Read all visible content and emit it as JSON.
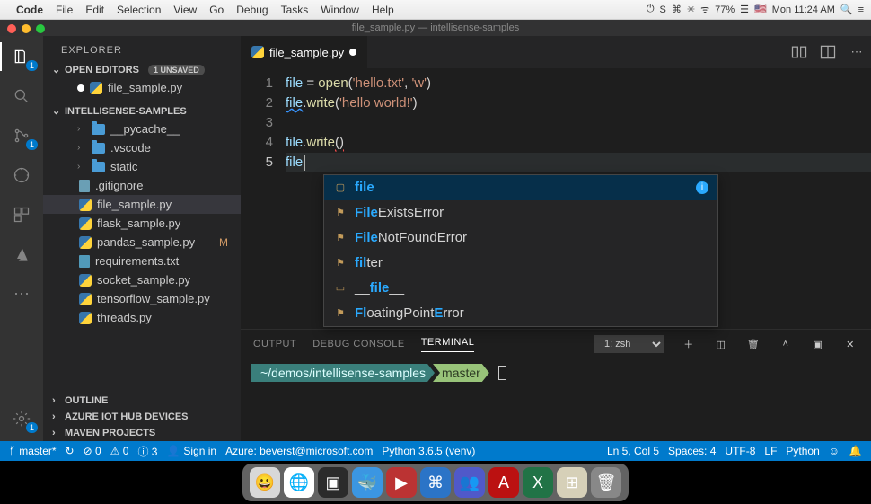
{
  "mac_menu": {
    "apple": "",
    "app": "Code",
    "items": [
      "File",
      "Edit",
      "Selection",
      "View",
      "Go",
      "Debug",
      "Tasks",
      "Window",
      "Help"
    ],
    "status_right": [
      "⏻",
      "S",
      "⌘",
      "✳",
      "ᯤ",
      "77%",
      "☰",
      "🇺🇸",
      "Mon 11:24 AM",
      "🔍",
      "≡"
    ]
  },
  "titlebar": "file_sample.py — intellisense-samples",
  "sidebar": {
    "title": "EXPLORER",
    "open_editors": {
      "label": "OPEN EDITORS",
      "badge": "1 UNSAVED"
    },
    "open_editor_item": "file_sample.py",
    "project": "INTELLISENSE-SAMPLES",
    "folders": [
      "__pycache__",
      ".vscode",
      "static"
    ],
    "files": [
      {
        "name": ".gitignore",
        "icon": "file"
      },
      {
        "name": "file_sample.py",
        "icon": "py",
        "selected": true
      },
      {
        "name": "flask_sample.py",
        "icon": "py"
      },
      {
        "name": "pandas_sample.py",
        "icon": "py",
        "modified": true
      },
      {
        "name": "requirements.txt",
        "icon": "txt"
      },
      {
        "name": "socket_sample.py",
        "icon": "py"
      },
      {
        "name": "tensorflow_sample.py",
        "icon": "py"
      },
      {
        "name": "threads.py",
        "icon": "py"
      }
    ],
    "sections_collapsed": [
      "OUTLINE",
      "AZURE IOT HUB DEVICES",
      "MAVEN PROJECTS"
    ]
  },
  "activity_badges": {
    "explorer": "1",
    "scm": "1",
    "settings": "1"
  },
  "tab": {
    "name": "file_sample.py"
  },
  "code": {
    "lines": [
      {
        "n": 1,
        "segs": [
          [
            "var",
            "file"
          ],
          [
            "op",
            " = "
          ],
          [
            "fn",
            "open"
          ],
          [
            "op",
            "("
          ],
          [
            "str",
            "'hello.txt'"
          ],
          [
            "op",
            ", "
          ],
          [
            "str",
            "'w'"
          ],
          [
            "op",
            ")"
          ]
        ]
      },
      {
        "n": 2,
        "segs": [
          [
            "var hint",
            "file"
          ],
          [
            "op",
            "."
          ],
          [
            "fn",
            "write"
          ],
          [
            "op",
            "("
          ],
          [
            "str",
            "'hello world!'"
          ],
          [
            "op",
            ")"
          ]
        ]
      },
      {
        "n": 3,
        "segs": []
      },
      {
        "n": 4,
        "segs": [
          [
            "var",
            "file"
          ],
          [
            "op",
            "."
          ],
          [
            "fn",
            "write"
          ],
          [
            "op err",
            "()"
          ]
        ]
      },
      {
        "n": 5,
        "active": true,
        "segs": [
          [
            "var",
            "file"
          ]
        ]
      }
    ]
  },
  "suggest": [
    {
      "icon": "▢",
      "pre": "",
      "hl": "file",
      "post": "",
      "selected": true,
      "info": true
    },
    {
      "icon": "⚑",
      "pre": "",
      "hl": "File",
      "post": "ExistsError"
    },
    {
      "icon": "⚑",
      "pre": "",
      "hl": "File",
      "post": "NotFoundError"
    },
    {
      "icon": "⚑",
      "pre": "",
      "hl": "fil",
      "post": "ter"
    },
    {
      "icon": "▭",
      "pre": "__",
      "hl": "file",
      "post": "__"
    },
    {
      "icon": "⚑",
      "pre": "",
      "hl": "Fl",
      "post": "oatingPoint",
      "hl2": "E",
      "post2": "rror"
    }
  ],
  "panel": {
    "tabs": [
      "OUTPUT",
      "DEBUG CONSOLE",
      "TERMINAL"
    ],
    "active_tab": "TERMINAL",
    "select": "1: zsh",
    "prompt_path": "~/demos/intellisense-samples",
    "prompt_branch": " master"
  },
  "status": {
    "branch": "master*",
    "sync": "↻",
    "errors": "⊘ 0",
    "warnings": "⚠ 0",
    "info": "ⓘ 3",
    "signin": "Sign in",
    "azure": "Azure: beverst@microsoft.com",
    "python": "Python 3.6.5 (venv)",
    "ln": "Ln 5, Col 5",
    "spaces": "Spaces: 4",
    "enc": "UTF-8",
    "eol": "LF",
    "lang": "Python",
    "smile": "☺",
    "bell": "🔔"
  },
  "dock_icons": [
    {
      "bg": "#d8d8d8",
      "g": "😀"
    },
    {
      "bg": "#fff",
      "g": "🌐"
    },
    {
      "bg": "#2b2b2b",
      "g": "▣"
    },
    {
      "bg": "#3b96e2",
      "g": "🐳"
    },
    {
      "bg": "#b33",
      "g": "▶"
    },
    {
      "bg": "#2b74c7",
      "g": "⌘"
    },
    {
      "bg": "#5059c9",
      "g": "👥"
    },
    {
      "bg": "#b11",
      "g": "A"
    },
    {
      "bg": "#217346",
      "g": "X"
    },
    {
      "bg": "#d6d0b8",
      "g": "⊞"
    },
    {
      "bg": "#888",
      "g": "🗑"
    }
  ]
}
